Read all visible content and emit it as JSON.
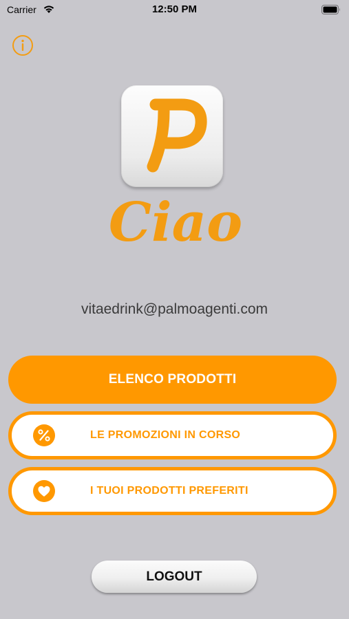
{
  "status_bar": {
    "carrier": "Carrier",
    "time": "12:50 PM"
  },
  "icons": {
    "info": "info-icon",
    "promo": "percent-icon",
    "favorites": "heart-icon"
  },
  "logo": {
    "letter": "P",
    "greeting": "Ciao"
  },
  "user": {
    "email": "vitaedrink@palmoagenti.com"
  },
  "buttons": {
    "products": "ELENCO PRODOTTI",
    "promotions": "LE PROMOZIONI IN CORSO",
    "favorites": "I TUOI PRODOTTI PREFERITI",
    "logout": "LOGOUT"
  },
  "colors": {
    "accent": "#ff9800",
    "background": "#c8c7cc"
  }
}
